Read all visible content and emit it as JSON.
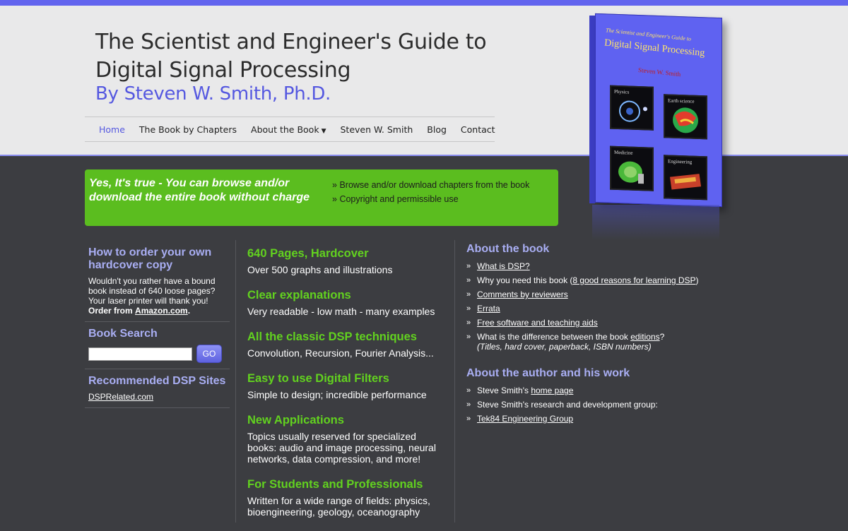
{
  "header": {
    "title_line1": "The Scientist and Engineer's Guide to",
    "title_line2": "Digital Signal Processing",
    "author": "By Steven W. Smith, Ph.D."
  },
  "nav": {
    "items": [
      "Home",
      "The Book by Chapters",
      "About the Book",
      "Steven W. Smith",
      "Blog",
      "Contact"
    ]
  },
  "book_cover": {
    "small_title": "The Scientist and Engineer's Guide to",
    "big_title": "Digital Signal Processing",
    "author": "Steven W. Smith",
    "tiles": [
      "Physics",
      "Earth science",
      "Medicine",
      "Engineering"
    ]
  },
  "banner": {
    "text": "Yes, It's true - You can browse and/or download the entire book without charge",
    "links": [
      "Browse and/or download chapters from the book",
      "Copyright and permissible use"
    ]
  },
  "left": {
    "order_head": "How to order your own hardcover copy",
    "order_text": "Wouldn't you rather have a bound book instead of 640 loose pages? Your laser printer will thank you!",
    "order_from": "Order from",
    "amazon": "Amazon.com",
    "period": ".",
    "search_head": "Book Search",
    "go": "GO",
    "sites_head": "Recommended DSP Sites",
    "site1": "DSPRelated.com"
  },
  "mid": [
    {
      "head": "640 Pages, Hardcover",
      "text": "Over 500 graphs and illustrations"
    },
    {
      "head": "Clear explanations",
      "text": "Very readable - low math - many examples"
    },
    {
      "head": "All the classic DSP techniques",
      "text": "Convolution, Recursion, Fourier Analysis..."
    },
    {
      "head": "Easy to use Digital Filters",
      "text": "Simple to design; incredible performance"
    },
    {
      "head": "New Applications",
      "text": "Topics usually reserved for specialized books: audio and image processing, neural networks, data compression, and more!"
    },
    {
      "head": "For Students and Professionals",
      "text": "Written for a wide range of fields: physics, bioengineering, geology, oceanography"
    }
  ],
  "right": {
    "about_book_head": "About the book",
    "what_is_dsp": "What is DSP?",
    "why_pre": "Why you need this book (",
    "why_link": "8 good reasons for learning DSP",
    "why_post": ")",
    "comments": "Comments by reviewers",
    "errata": "Errata",
    "free_sw": "Free software and teaching aids",
    "editions_pre": "What is the difference between the book ",
    "editions_link": "editions",
    "editions_post": "?",
    "editions_sub": "(Titles, hard cover, paperback, ISBN numbers)",
    "about_author_head": "About the author and his work",
    "home_pre": "Steve Smith's ",
    "home_link": "home page",
    "research": "Steve Smith's research and development group:",
    "tek84": "Tek84 Engineering Group"
  }
}
